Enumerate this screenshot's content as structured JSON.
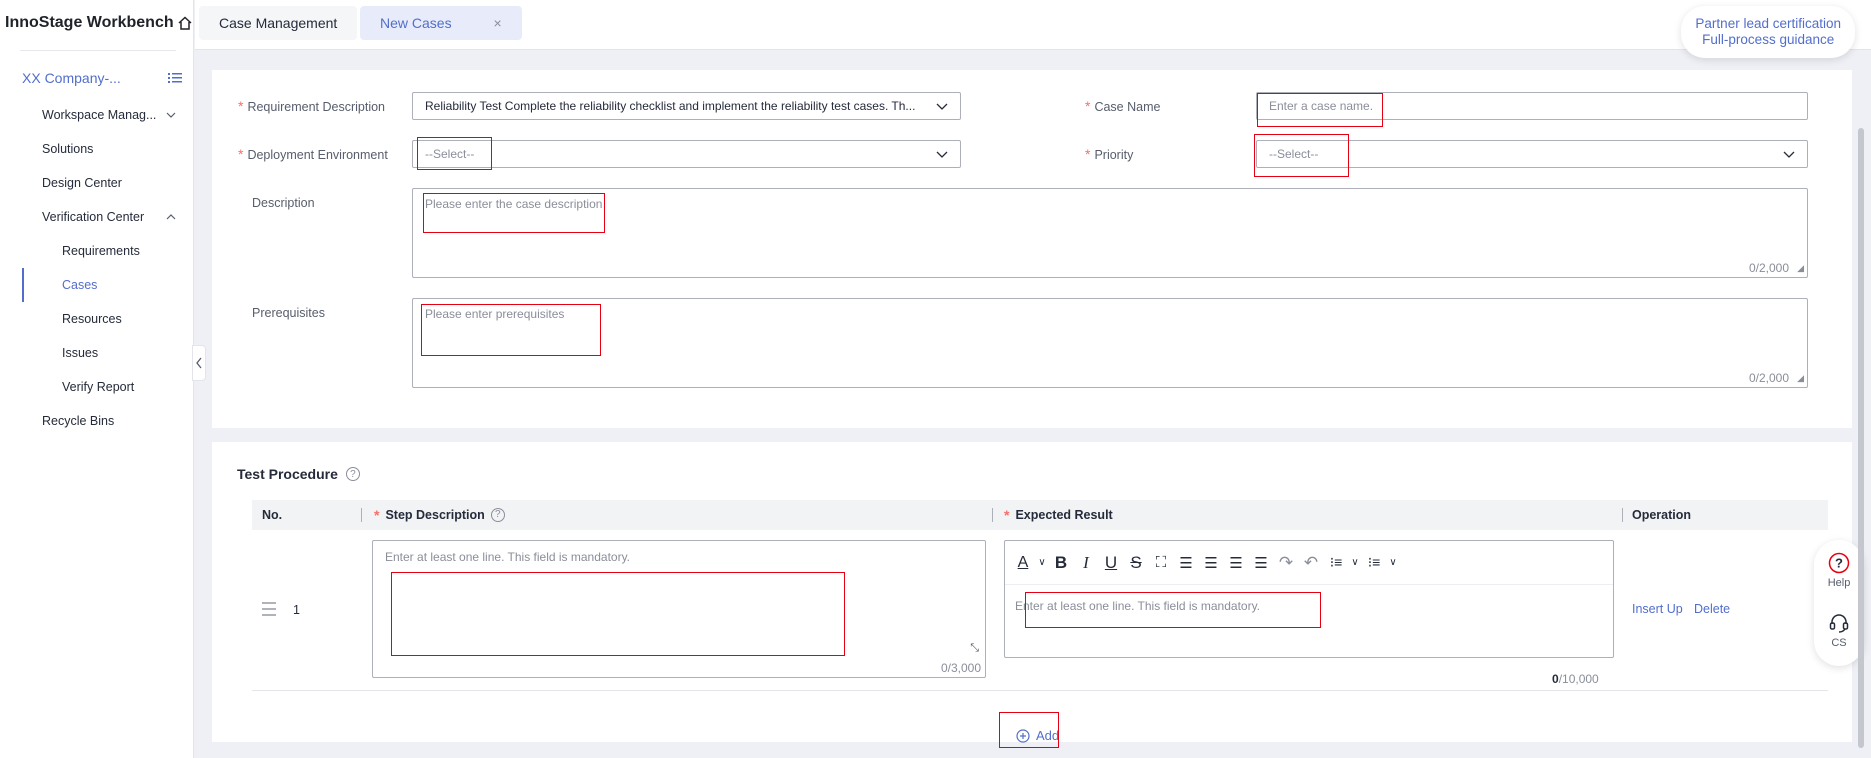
{
  "app": {
    "brand": "InnoStage Workbench"
  },
  "sidebar": {
    "company": "XX Company-...",
    "items": [
      {
        "label": "Workspace Manag...",
        "type": "top",
        "chevron": "down"
      },
      {
        "label": "Solutions",
        "type": "top"
      },
      {
        "label": "Design Center",
        "type": "top"
      },
      {
        "label": "Verification Center",
        "type": "top",
        "chevron": "up"
      },
      {
        "label": "Requirements",
        "type": "sub"
      },
      {
        "label": "Cases",
        "type": "sub",
        "active": true
      },
      {
        "label": "Resources",
        "type": "sub"
      },
      {
        "label": "Issues",
        "type": "sub"
      },
      {
        "label": "Verify Report",
        "type": "sub"
      },
      {
        "label": "Recycle Bins",
        "type": "top"
      }
    ]
  },
  "tabs": [
    {
      "label": "Case Management",
      "active": false
    },
    {
      "label": "New Cases",
      "active": true,
      "close": "×"
    }
  ],
  "partner": {
    "line1": "Partner lead certification",
    "line2": "Full-process guidance"
  },
  "form": {
    "requirement": {
      "label": "Requirement Description",
      "value": "Reliability Test Complete the reliability checklist and implement the reliability test cases. Th..."
    },
    "case_name": {
      "label": "Case Name",
      "placeholder": "Enter a case name."
    },
    "deployment": {
      "label": "Deployment Environment",
      "value": "--Select--"
    },
    "priority": {
      "label": "Priority",
      "value": "--Select--"
    },
    "description": {
      "label": "Description",
      "placeholder": "Please enter the case description",
      "counter": "0/2,000"
    },
    "prerequisites": {
      "label": "Prerequisites",
      "placeholder": "Please enter prerequisites",
      "counter": "0/2,000"
    }
  },
  "procedure": {
    "title": "Test Procedure",
    "columns": {
      "no": "No.",
      "step": "Step Description",
      "expected": "Expected Result",
      "operation": "Operation"
    },
    "rows": [
      {
        "no": "1",
        "step_placeholder": "Enter at least one line. This field is mandatory.",
        "step_counter": "0/3,000",
        "expected_placeholder": "Enter at least one line. This field is mandatory.",
        "expected_counter_bold": "0",
        "expected_counter_rest": "/10,000",
        "ops": [
          "Insert Up",
          "Delete"
        ]
      }
    ],
    "add_label": "Add"
  },
  "float": {
    "help": "Help",
    "cs": "CS"
  },
  "colors": {
    "accent": "#526ecc",
    "required": "#f66f6a",
    "highlight": "#e60012"
  }
}
